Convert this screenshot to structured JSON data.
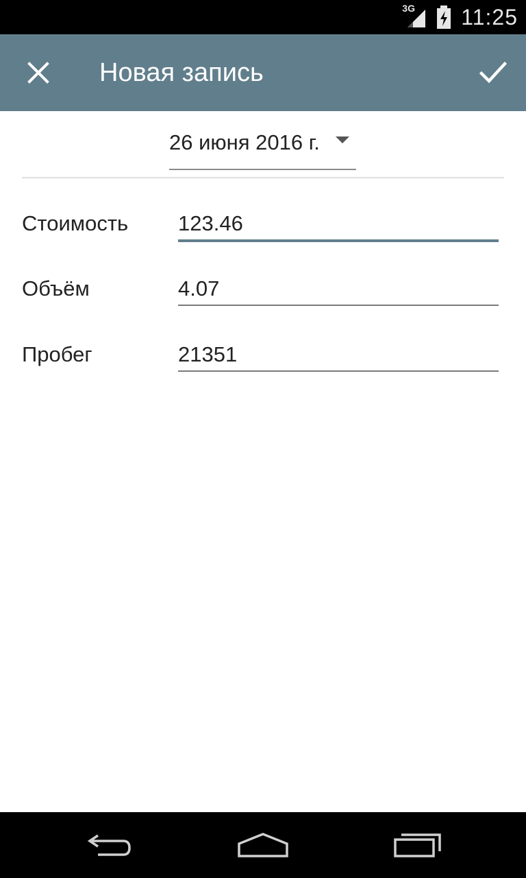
{
  "status_bar": {
    "network": "3G",
    "time": "11:25"
  },
  "app_bar": {
    "title": "Новая запись",
    "close_icon": "close-icon",
    "confirm_icon": "check-icon",
    "color": "#617e8c"
  },
  "date": {
    "value": "26 июня 2016 г."
  },
  "fields": [
    {
      "label": "Стоимость",
      "value": "123.46"
    },
    {
      "label": "Объём",
      "value": "4.07"
    },
    {
      "label": "Пробег",
      "value": "21351"
    }
  ],
  "nav_bar": {
    "back_icon": "back-icon",
    "home_icon": "home-icon",
    "recents_icon": "recents-icon"
  }
}
